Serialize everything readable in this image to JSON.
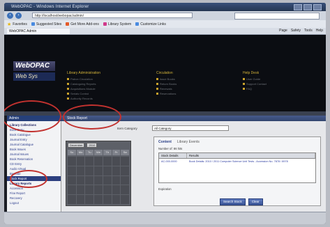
{
  "browser": {
    "window_title": "WebOPAC - Windows Internet Explorer",
    "url": "http://localhost/webopac/admin/",
    "tab_label": "WebOPAC Admin",
    "favorites": [
      {
        "label": "Favorites",
        "icon": "star-icon"
      },
      {
        "label": "Suggested Sites",
        "icon": "site-icon"
      },
      {
        "label": "Get More Add-ons",
        "icon": "addon-icon"
      },
      {
        "label": "Library System",
        "icon": "link-icon"
      },
      {
        "label": "Customize Links",
        "icon": "link-icon"
      }
    ],
    "command_bar": [
      "Page",
      "Safety",
      "Tools",
      "Help"
    ]
  },
  "header": {
    "logo_top": "WebOPAC",
    "logo_bottom": "Web Sys",
    "columns": [
      {
        "heading": "Library Administration",
        "links": [
          "Patron Circulation",
          "Cataloguing Reports",
          "Acquisitions Module",
          "Serials Control",
          "Authority Records"
        ]
      },
      {
        "heading": "Circulation",
        "links": [
          "Issue Books",
          "Return Books",
          "Renewals",
          "Reservations"
        ]
      },
      {
        "heading": "Help Desk",
        "links": [
          "User Guide",
          "Support Contact",
          "FAQ"
        ]
      }
    ]
  },
  "sidebar": {
    "title": "Admin",
    "items": [
      {
        "label": "Library Collections",
        "bold": true
      },
      {
        "label": "Book Entry"
      },
      {
        "label": "Book Catalogue"
      },
      {
        "label": "Journal Entry"
      },
      {
        "label": "Journal Catalogue"
      },
      {
        "label": "Book Issues"
      },
      {
        "label": "Journal Issues"
      },
      {
        "label": "Book Reservation"
      },
      {
        "label": "CD Entry"
      },
      {
        "label": "Audio Visual"
      },
      {
        "label": "Barcode"
      },
      {
        "label": "Stock Report",
        "selected": true
      },
      {
        "label": "Library Reports",
        "bold": true
      },
      {
        "label": "Accession"
      },
      {
        "label": "Fine Report"
      },
      {
        "label": "Recovery"
      },
      {
        "label": "Logout"
      }
    ]
  },
  "main": {
    "panel_title": "Stock Report",
    "field_label": "Item Category",
    "field_value": "All Category",
    "calendar": {
      "month": "December",
      "year": "2010",
      "days": [
        "Su",
        "Mo",
        "Tu",
        "We",
        "Th",
        "Fr",
        "Sa"
      ]
    },
    "results": {
      "tabs": [
        "Content",
        "Library Events"
      ],
      "number_label": "Number of: 86 hits",
      "columns": [
        "Stock Details",
        "Results"
      ],
      "rows": [
        {
          "id": "AC-000-0000",
          "detail": "Book Details: 2010 / 2011 Computer Science Unit Tests - Accession No. 7878 / 8978"
        }
      ],
      "footer_label": "Expiration",
      "buttons": [
        "Search Stock",
        "Clear"
      ]
    }
  },
  "colors": {
    "accent": "#c2322f",
    "header_bg": "#0b0d12",
    "link_gold": "#c9a22c",
    "panel_blue": "#32456f"
  }
}
